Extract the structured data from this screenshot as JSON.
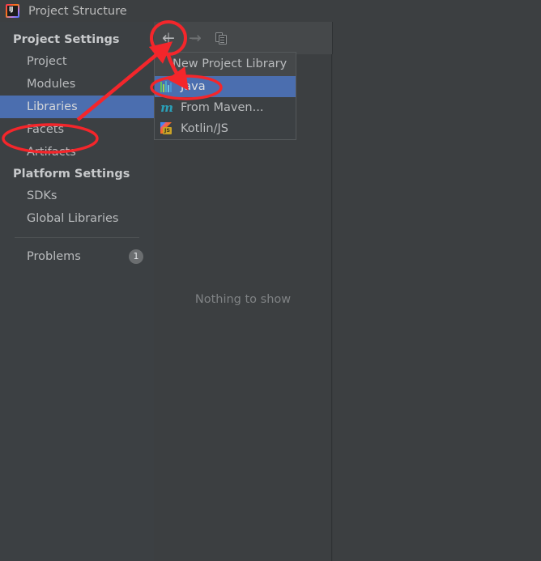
{
  "window": {
    "title": "Project Structure",
    "logo_icon": "intellij-idea-logo",
    "logo_text": "IJ"
  },
  "toolbar": {
    "back_icon": "back-arrow-icon",
    "back_glyph": "←",
    "forward_icon": "forward-arrow-icon",
    "forward_glyph": "→",
    "add_icon": "plus-icon",
    "add_glyph": "+",
    "remove_icon": "minus-icon",
    "remove_glyph": "–",
    "copy_icon": "copy-icon"
  },
  "sidebar": {
    "groups": [
      {
        "label": "Project Settings",
        "items": [
          {
            "label": "Project",
            "selected": false
          },
          {
            "label": "Modules",
            "selected": false
          },
          {
            "label": "Libraries",
            "selected": true
          },
          {
            "label": "Facets",
            "selected": false
          },
          {
            "label": "Artifacts",
            "selected": false
          }
        ]
      },
      {
        "label": "Platform Settings",
        "items": [
          {
            "label": "SDKs",
            "selected": false
          },
          {
            "label": "Global Libraries",
            "selected": false
          }
        ]
      }
    ],
    "problems": {
      "label": "Problems",
      "badge": "1"
    }
  },
  "center_panel": {
    "empty_text": "Nothing to show"
  },
  "dropdown": {
    "header": "New Project Library",
    "items": [
      {
        "label": "Java",
        "icon": "java-icon",
        "selected": true
      },
      {
        "label": "From Maven...",
        "icon": "maven-icon",
        "selected": false
      },
      {
        "label": "Kotlin/JS",
        "icon": "kotlin-js-icon",
        "selected": false,
        "badge_text": "JS"
      }
    ]
  },
  "colors": {
    "accent_selection": "#4b6eaf",
    "annotation_red": "#f4262b",
    "sidebar_bg": "#3c4043",
    "panel_bg": "#3c3f41",
    "toolbar_bg": "#45484a",
    "titlebar_bg": "#3c3f41"
  },
  "annotations": {
    "circle_plus": "red-ellipse-around-add-button",
    "circle_libraries": "red-ellipse-around-libraries-item",
    "circle_java": "red-ellipse-around-java-menu-item",
    "arrow_to_plus": "red-arrow-pointing-to-add-button",
    "arrow_to_java": "red-arrow-pointing-to-java-item"
  }
}
